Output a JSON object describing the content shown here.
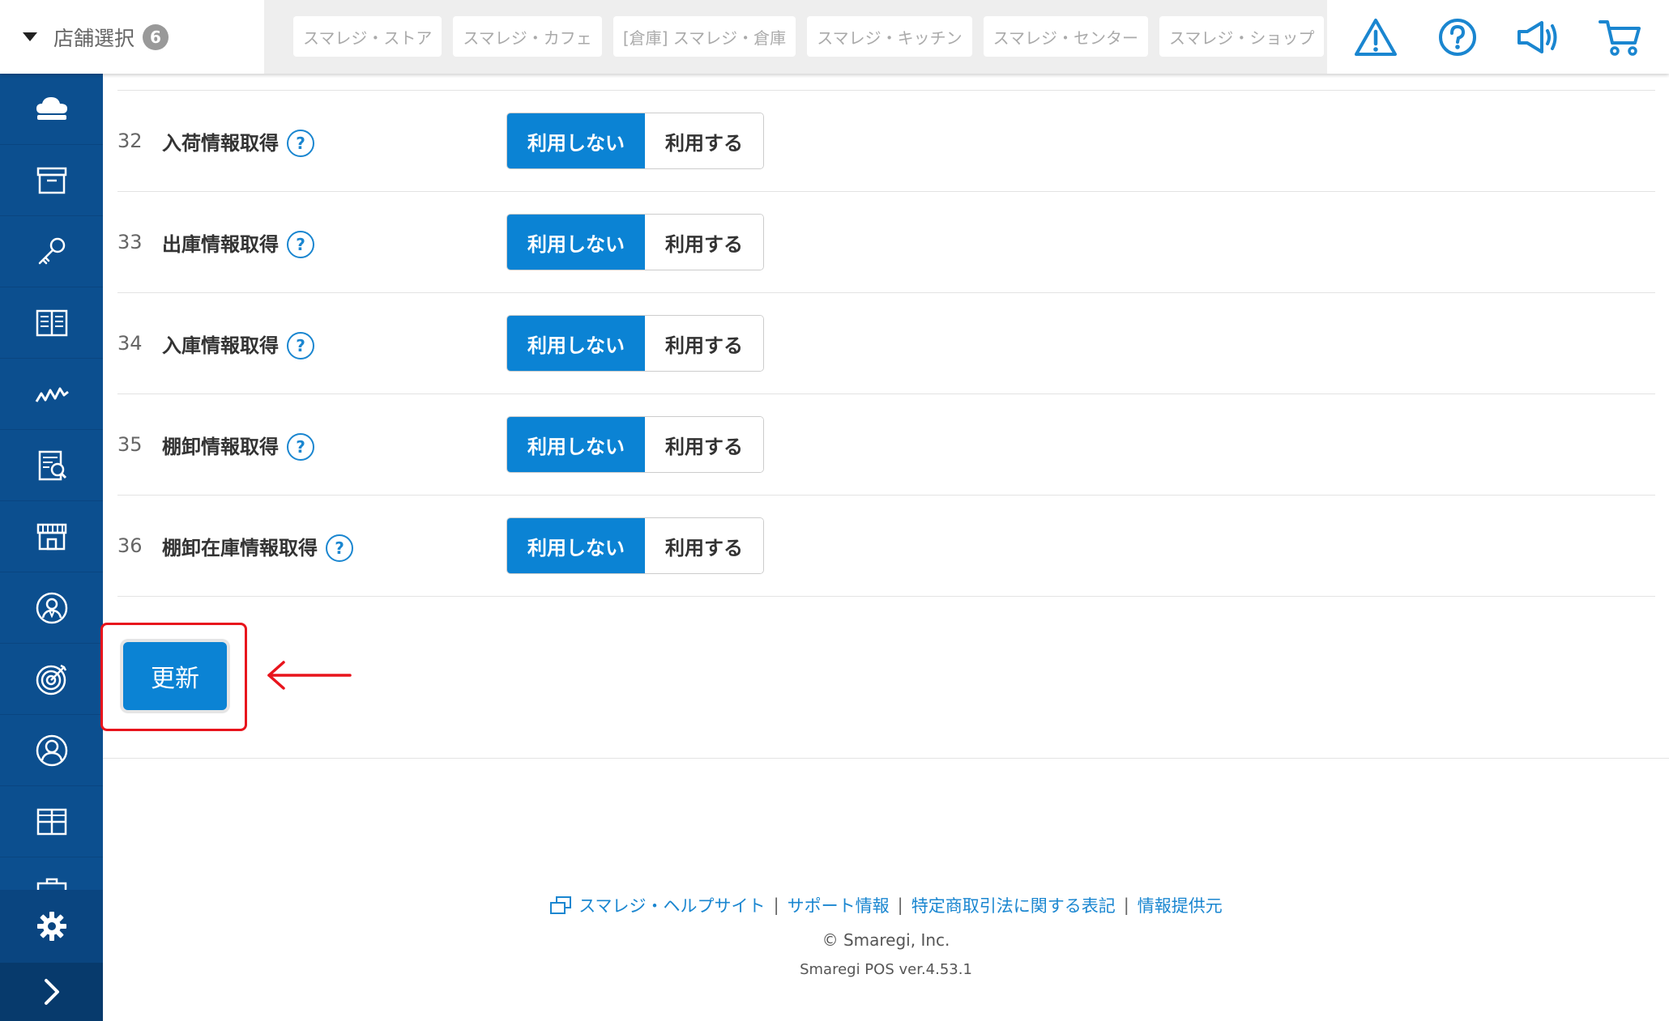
{
  "header": {
    "store_select_label": "店舗選択",
    "store_count": "6",
    "store_tabs": [
      "スマレジ・ストア",
      "スマレジ・カフェ",
      "[倉庫] スマレジ・倉庫",
      "スマレジ・キッチン",
      "スマレジ・センター",
      "スマレジ・ショップ"
    ],
    "icons": [
      "warning-icon",
      "help-icon",
      "megaphone-icon",
      "cart-icon"
    ]
  },
  "sidebar": {
    "items": [
      "cloud-icon",
      "inbox-icon",
      "key-icon",
      "book-icon",
      "sales-chart-icon",
      "report-icon",
      "store-icon",
      "customer-icon",
      "target-icon",
      "user-icon",
      "grid-icon",
      "briefcase-icon"
    ],
    "settings": "gear-icon",
    "expand": "chevron-right-icon"
  },
  "settings_rows": [
    {
      "num": "32",
      "name": "入荷情報取得",
      "off": "利用しない",
      "on": "利用する",
      "selected": "off"
    },
    {
      "num": "33",
      "name": "出庫情報取得",
      "off": "利用しない",
      "on": "利用する",
      "selected": "off"
    },
    {
      "num": "34",
      "name": "入庫情報取得",
      "off": "利用しない",
      "on": "利用する",
      "selected": "off"
    },
    {
      "num": "35",
      "name": "棚卸情報取得",
      "off": "利用しない",
      "on": "利用する",
      "selected": "off"
    },
    {
      "num": "36",
      "name": "棚卸在庫情報取得",
      "off": "利用しない",
      "on": "利用する",
      "selected": "off"
    }
  ],
  "help_mark": "?",
  "update_button": "更新",
  "footer": {
    "links": [
      "スマレジ・ヘルプサイト",
      "サポート情報",
      "特定商取引法に関する表記",
      "情報提供元"
    ],
    "separator": "|",
    "copyright": "© Smaregi, Inc.",
    "version": "Smaregi POS ver.4.53.1"
  },
  "colors": {
    "accent": "#0b83d4",
    "sidebar": "#0c4f8f",
    "highlight": "#e8141c"
  }
}
